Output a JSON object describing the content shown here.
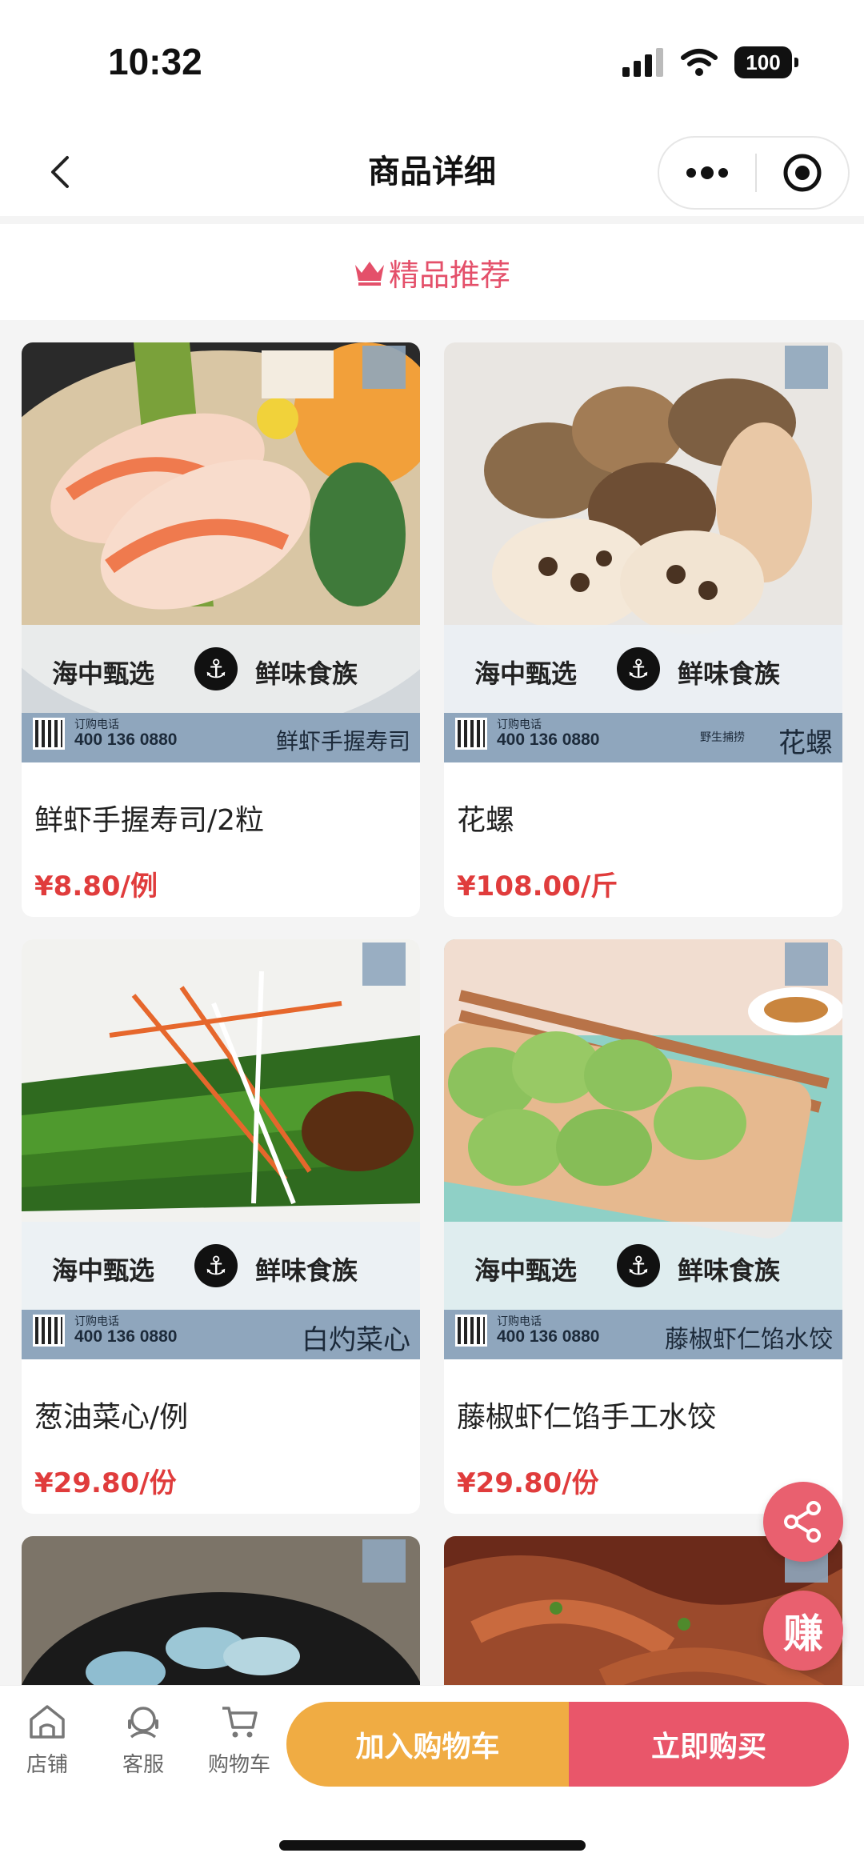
{
  "status_bar": {
    "time": "10:32",
    "battery": "100"
  },
  "nav": {
    "title": "商品详细"
  },
  "section": {
    "title": "精品推荐"
  },
  "products": [
    {
      "name": "鲜虾手握寿司/2粒",
      "price": "¥8.80/例",
      "strip_name": "鲜虾手握寿司"
    },
    {
      "name": "花螺",
      "price": "¥108.00/斤",
      "strip_name": "花螺",
      "strip_sub": "野生捕捞"
    },
    {
      "name": "葱油菜心/例",
      "price": "¥29.80/份",
      "strip_name": "白灼菜心"
    },
    {
      "name": "藤椒虾仁馅手工水饺",
      "price": "¥29.80/份",
      "strip_name": "藤椒虾仁馅水饺"
    }
  ],
  "banner": {
    "left": "海中甄选",
    "right": "鲜味食族",
    "anchor": "⚓",
    "phone_label": "订购电话",
    "phone": "400 136 0880"
  },
  "floating": {
    "earn": "赚"
  },
  "bottom_bar": {
    "tabs": [
      {
        "label": "店铺",
        "icon": "store-icon"
      },
      {
        "label": "客服",
        "icon": "customer-service-icon"
      },
      {
        "label": "购物车",
        "icon": "cart-icon"
      }
    ],
    "add_to_cart": "加入购物车",
    "buy_now": "立即购买"
  },
  "colors": {
    "accent_pink": "#e4506a",
    "price_red": "#e03c3c",
    "cart_orange": "#f0ac43",
    "buy_pink": "#e9566a"
  }
}
